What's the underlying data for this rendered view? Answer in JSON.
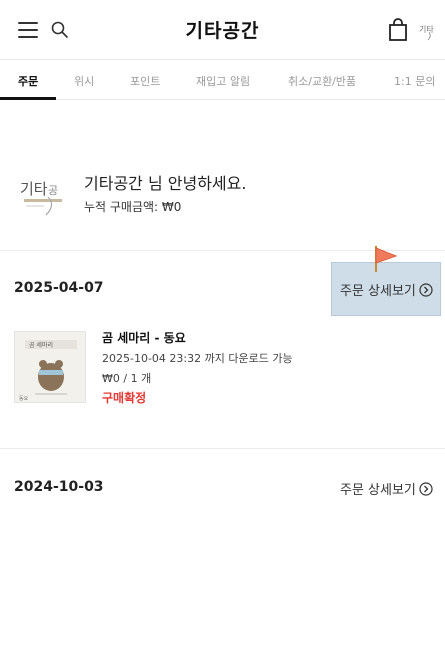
{
  "header": {
    "title": "기타공간",
    "menu_icon": "hamburger-menu-icon",
    "search_icon": "search-icon",
    "bag_icon": "shopping-bag-icon"
  },
  "tabs": [
    {
      "label": "주문",
      "active": true
    },
    {
      "label": "위시",
      "active": false
    },
    {
      "label": "포인트",
      "active": false
    },
    {
      "label": "재입고 알림",
      "active": false
    },
    {
      "label": "취소/교환/반품",
      "active": false
    },
    {
      "label": "1:1 문의",
      "active": false
    }
  ],
  "welcome": {
    "greeting": "기타공간 님 안녕하세요.",
    "total_purchase": "누적 구매금액: ₩0"
  },
  "orders": [
    {
      "date": "2025-04-07",
      "detail_label": "주문 상세보기",
      "item": {
        "title": "곰 세마리 - 동요",
        "download": "2025-10-04 23:32 까지 다운로드 가능",
        "price_qty": "₩0 / 1 개",
        "status": "구매확정"
      }
    },
    {
      "date": "2024-10-03",
      "detail_label": "주문 상세보기"
    }
  ],
  "colors": {
    "accent_status": "#e53935",
    "highlight_box": "#cfdde8",
    "flag": "#f07a5b"
  }
}
